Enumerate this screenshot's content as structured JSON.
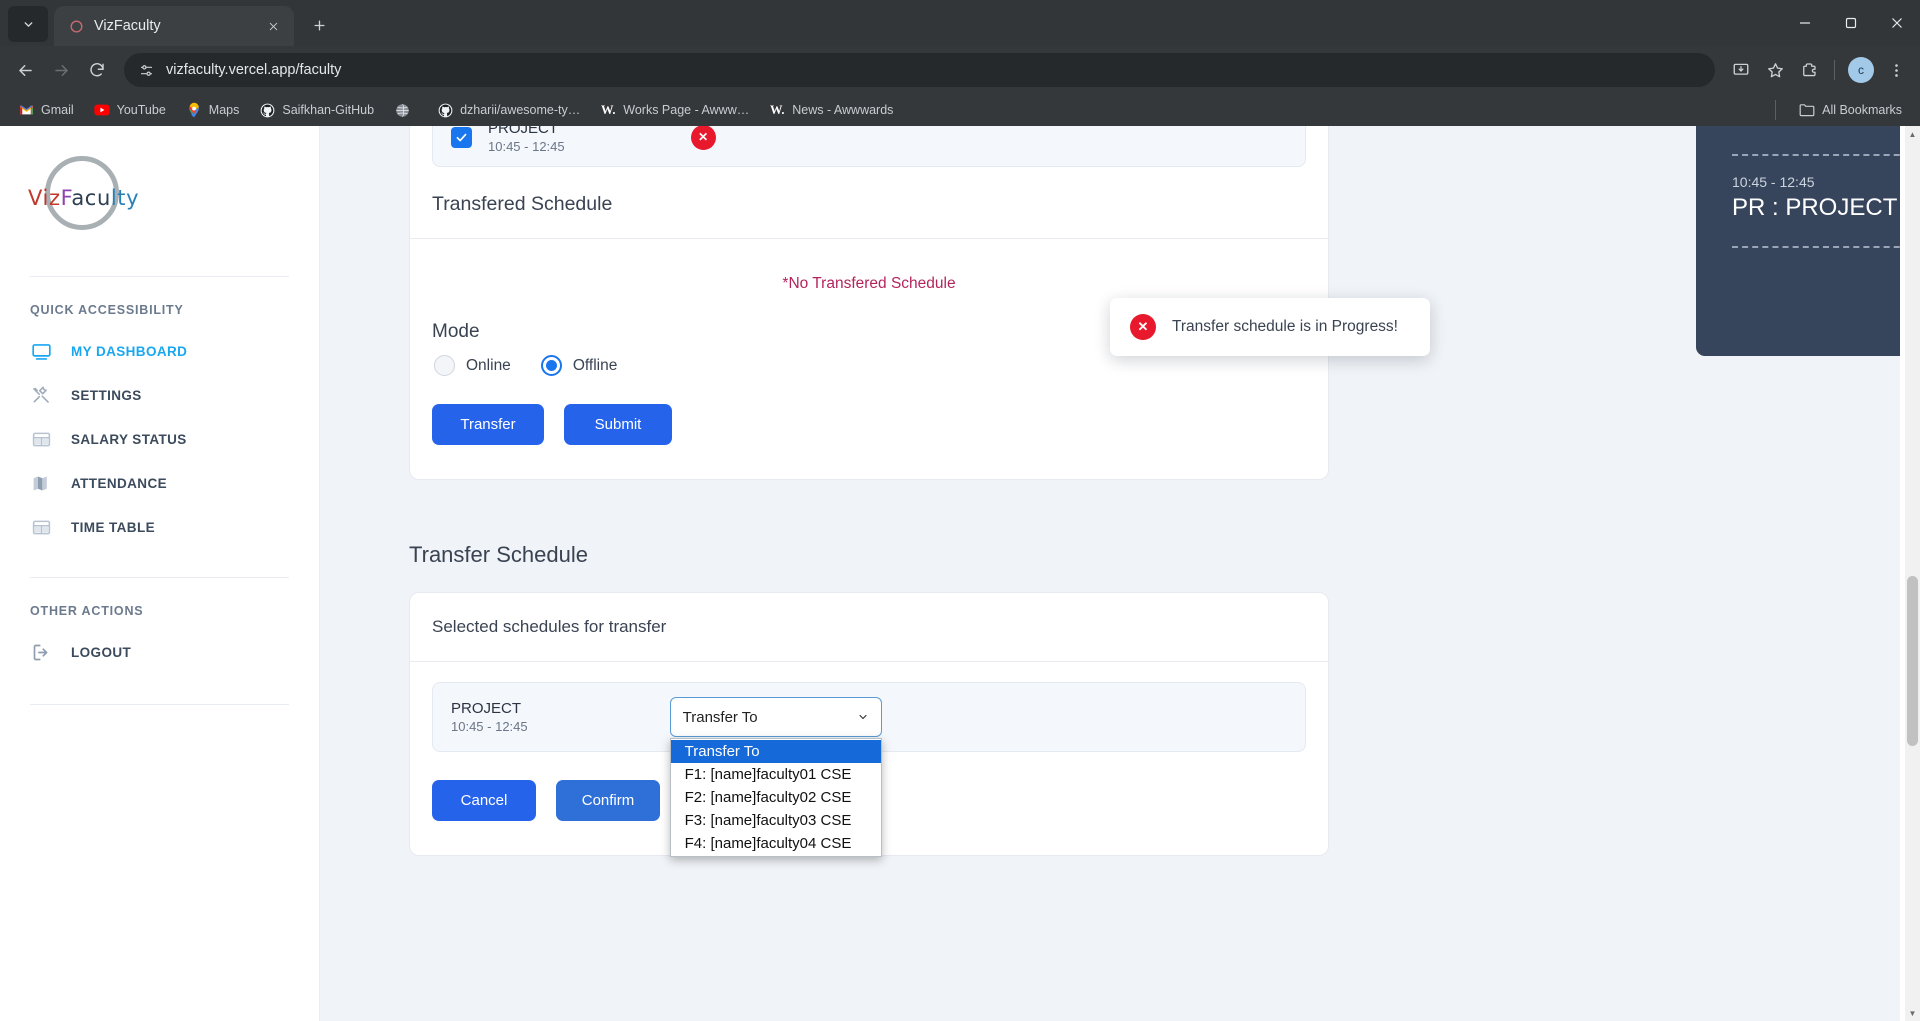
{
  "browser": {
    "tab": {
      "title": "VizFaculty",
      "favicon_icon": "vizfaculty-favicon",
      "close_icon": "close-icon"
    },
    "tab_search_icon": "chevron-down-icon",
    "new_tab_icon": "plus-icon",
    "window_controls": {
      "minimize": "minimize-icon",
      "maximize": "maximize-icon",
      "close": "close-icon"
    },
    "nav": {
      "back_icon": "back-arrow-icon",
      "forward_icon": "forward-arrow-icon",
      "reload_icon": "reload-icon"
    },
    "omnibox": {
      "site_settings_icon": "tune-icon",
      "url": "vizfaculty.vercel.app/faculty"
    },
    "toolbar_icons": [
      "install-app-icon",
      "bookmark-star-icon",
      "extensions-icon"
    ],
    "profile_initial": "c",
    "menu_icon": "three-dot-menu-icon",
    "bookmarks": [
      {
        "label": "Gmail",
        "icon": "gmail-icon"
      },
      {
        "label": "YouTube",
        "icon": "youtube-icon"
      },
      {
        "label": "Maps",
        "icon": "maps-icon"
      },
      {
        "label": "Saifkhan-GitHub",
        "icon": "github-icon"
      },
      {
        "label": "",
        "icon": "globe-icon"
      },
      {
        "label": "dzharii/awesome-ty…",
        "icon": "github-icon"
      },
      {
        "label": "Works Page - Awww…",
        "icon": "awwwards-icon"
      },
      {
        "label": "News - Awwwards",
        "icon": "awwwards-icon"
      }
    ],
    "all_bookmarks": {
      "label": "All Bookmarks",
      "icon": "folder-icon"
    }
  },
  "sidebar": {
    "logo": {
      "part1": "Viz",
      "part2": "F",
      "part3": "acu",
      "part4": "lty"
    },
    "section_quick": "QUICK ACCESSIBILITY",
    "items": [
      {
        "label": "MY DASHBOARD",
        "icon": "monitor-icon",
        "active": true
      },
      {
        "label": "SETTINGS",
        "icon": "tools-icon",
        "active": false
      },
      {
        "label": "SALARY STATUS",
        "icon": "table-icon",
        "active": false
      },
      {
        "label": "ATTENDANCE",
        "icon": "map-book-icon",
        "active": false
      },
      {
        "label": "TIME TABLE",
        "icon": "table-icon",
        "active": false
      }
    ],
    "section_other": "OTHER ACTIONS",
    "logout": {
      "label": "LOGOUT",
      "icon": "logout-icon"
    }
  },
  "toast": {
    "icon": "error-circle-icon",
    "message": "Transfer schedule is in Progress!"
  },
  "schedule_chip": {
    "name": "PROJECT",
    "time": "10:45 - 12:45",
    "checkbox_icon": "checkmark-icon",
    "delete_icon": "delete-x-icon",
    "checked": true
  },
  "transfered_section": {
    "title": "Transfered Schedule",
    "empty_message": "*No Transfered Schedule"
  },
  "mode": {
    "label": "Mode",
    "options": [
      {
        "label": "Online",
        "selected": false
      },
      {
        "label": "Offline",
        "selected": true
      }
    ]
  },
  "actions": {
    "transfer_label": "Transfer",
    "submit_label": "Submit"
  },
  "transfer_schedule": {
    "heading": "Transfer Schedule",
    "subheading": "Selected schedules for transfer",
    "row": {
      "name": "PROJECT",
      "time": "10:45 - 12:45"
    },
    "select": {
      "value": "Transfer To",
      "caret_icon": "chevron-down-icon",
      "open": true,
      "options": [
        "Transfer To",
        "F1: [name]faculty01 CSE",
        "F2: [name]faculty02 CSE",
        "F3: [name]faculty03 CSE",
        "F4: [name]faculty04 CSE"
      ],
      "selected_index": 0
    },
    "cancel_label": "Cancel",
    "confirm_label": "Confirm"
  },
  "right_panel": {
    "time": "10:45 - 12:45",
    "title": "PR : PROJECT"
  },
  "colors": {
    "accent_blue": "#2563eb",
    "sidebar_active": "#19a7f0",
    "danger_red": "#e8192c",
    "empty_text": "#b4245c",
    "panel_dark": "#36445c",
    "select_highlight": "#1669d8"
  }
}
